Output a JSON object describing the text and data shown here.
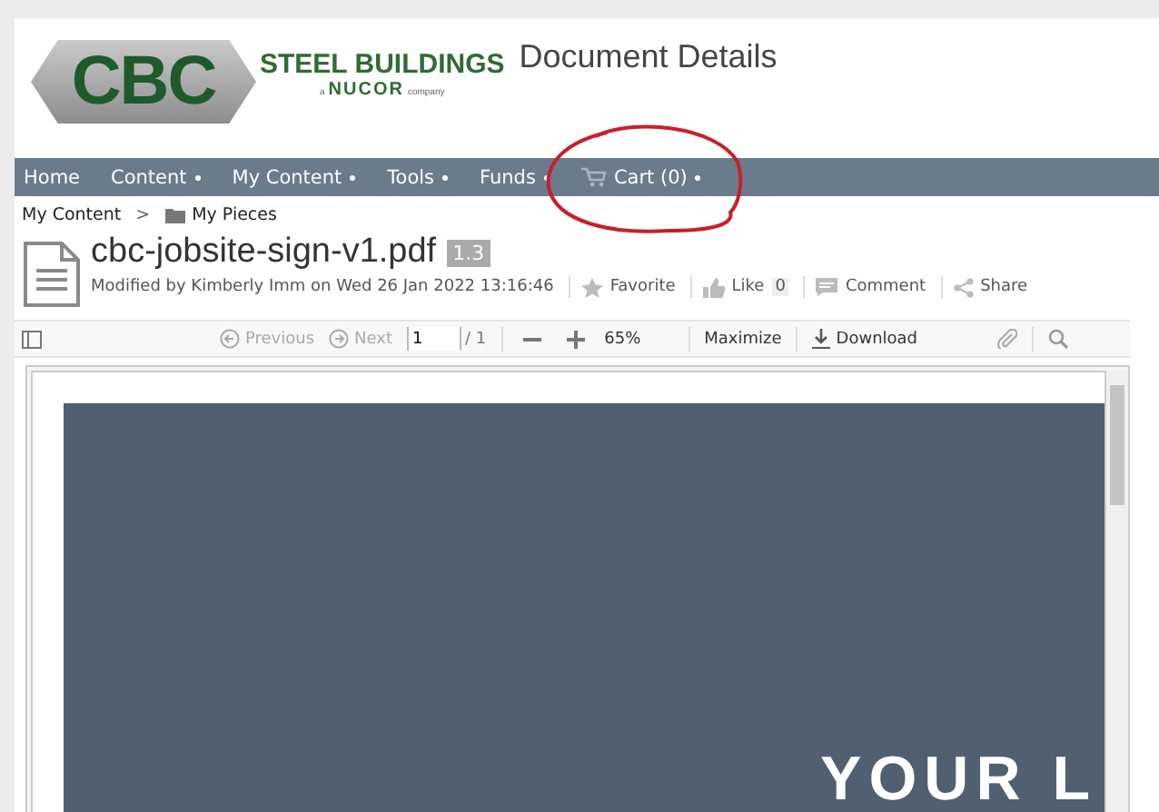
{
  "logo": {
    "badge": "CBC",
    "name": "STEEL BUILDINGS",
    "tagline_prefix": "a",
    "tagline_brand": "NUCOR",
    "tagline_suffix": "company"
  },
  "page_title": "Document Details",
  "nav": [
    {
      "label": "Home",
      "dropdown": false
    },
    {
      "label": "Content",
      "dropdown": true
    },
    {
      "label": "My Content",
      "dropdown": true
    },
    {
      "label": "Tools",
      "dropdown": true
    },
    {
      "label": "Funds",
      "dropdown": true
    },
    {
      "label": "Cart (0)",
      "dropdown": true,
      "kind": "cart"
    }
  ],
  "breadcrumb": [
    {
      "label": "My Content",
      "kind": "link"
    },
    {
      "label": ">",
      "kind": "separator"
    },
    {
      "label": "My Pieces",
      "kind": "folder"
    }
  ],
  "document": {
    "filename": "cbc-jobsite-sign-v1.pdf",
    "version": "1.3",
    "modified": "Modified by Kimberly Imm on Wed 26 Jan 2022 13:16:46"
  },
  "actions": [
    {
      "label": "Favorite",
      "kind": "star"
    },
    {
      "label": "Like",
      "kind": "like",
      "count": "0"
    },
    {
      "label": "Comment",
      "kind": "comment"
    },
    {
      "label": "Share",
      "kind": "share"
    }
  ],
  "viewer": {
    "previous": "Previous",
    "next": "Next",
    "page": "1",
    "page_total": "/ 1",
    "zoom": "65%",
    "maximize": "Maximize",
    "download": "Download",
    "page_text": "YOUR L"
  }
}
